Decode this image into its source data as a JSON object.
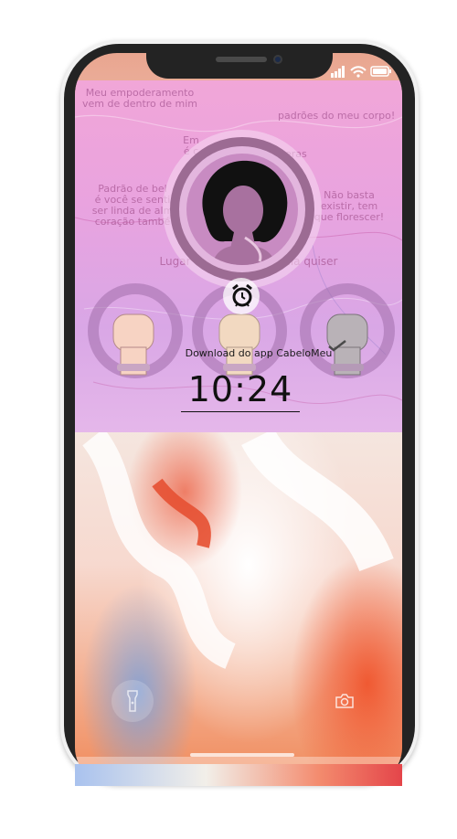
{
  "status_bar": {
    "signal_icon": "signal-bars-icon",
    "wifi_icon": "wifi-icon",
    "battery_icon": "battery-icon"
  },
  "wallpaper": {
    "texts": {
      "top_left": "Meu empoderamento\nvem de dentro de mim",
      "top_right": "padrões do meu corpo!",
      "mid_left": "Em\né c",
      "mid_right": "eras",
      "left_block": "Padrão de bel\né você se senti\nser linda de alm\ncoração també",
      "right_block": "Não basta\nexistir, tem\nque florescer!",
      "bottom": "Lugar de mul      onde ela quiser"
    }
  },
  "alarm": {
    "icon": "alarm-clock-icon"
  },
  "notification": {
    "text": "Download do app CabeloMeu",
    "check_icon": "checkmark-icon"
  },
  "clock": {
    "time": "10:24"
  },
  "lock_screen": {
    "flashlight_icon": "flashlight-icon",
    "camera_icon": "camera-icon"
  },
  "colors": {
    "poster_pink": "#eaa5dc",
    "phone_body": "#232323",
    "text_dark": "#111111"
  }
}
